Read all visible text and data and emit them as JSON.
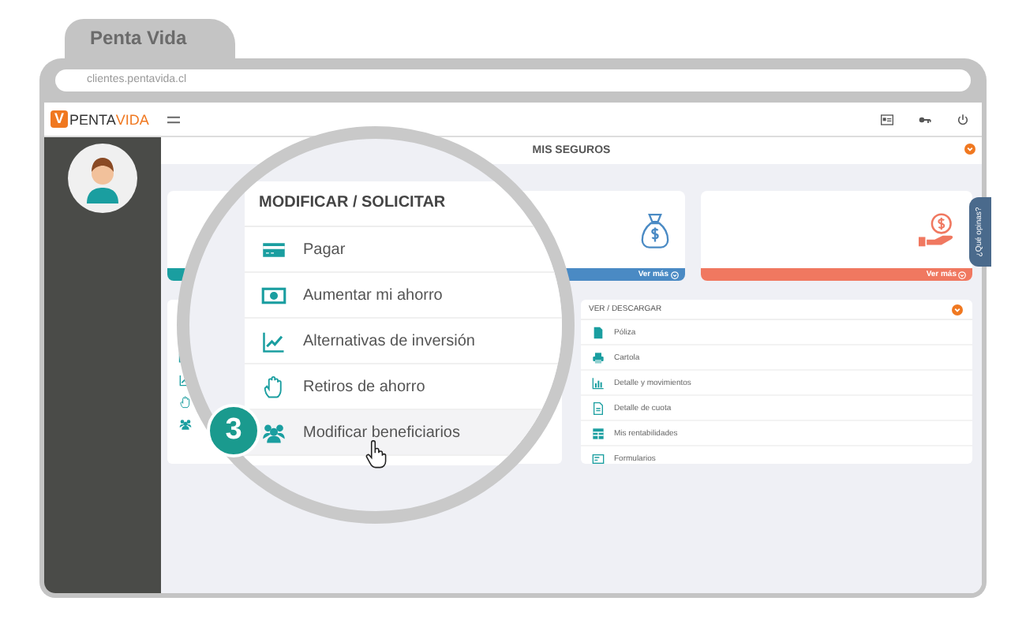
{
  "browser": {
    "tab_title": "Penta Vida",
    "url": "clientes.pentavida.cl"
  },
  "logo": {
    "mark": "V",
    "word_1": "PENTA",
    "word_2": "VIDA"
  },
  "section_title": "MIS SEGUROS",
  "cards": [
    {
      "kind": "plain",
      "color": "#1a9ea0"
    },
    {
      "kind": "money-bag",
      "color": "#4a8ac4",
      "link": "Ver más"
    },
    {
      "kind": "hand-coin",
      "color": "#f07860",
      "link": "Ver más"
    }
  ],
  "feedback_tab": "¿Qué opinas?",
  "modify_panel": {
    "items": [
      {
        "kind": "card"
      },
      {
        "kind": "cash"
      },
      {
        "kind": "chart"
      },
      {
        "kind": "hand"
      },
      {
        "kind": "people"
      }
    ]
  },
  "download_panel": {
    "title": "VER / DESCARGAR",
    "items": [
      {
        "kind": "document",
        "label": "Póliza"
      },
      {
        "kind": "printer",
        "label": "Cartola"
      },
      {
        "kind": "bar-chart",
        "label": "Detalle y movimientos"
      },
      {
        "kind": "receipt",
        "label": "Detalle de cuota"
      },
      {
        "kind": "table",
        "label": "Mis rentabilidades"
      },
      {
        "kind": "form",
        "label": "Formularios"
      }
    ]
  },
  "magnifier": {
    "title": "MODIFICAR / SOLICITAR",
    "items": [
      {
        "kind": "card",
        "label": "Pagar",
        "selected": false
      },
      {
        "kind": "cash",
        "label": "Aumentar mi ahorro",
        "selected": false
      },
      {
        "kind": "chart",
        "label": "Alternativas de inversión",
        "selected": false
      },
      {
        "kind": "hand",
        "label": "Retiros de ahorro",
        "selected": false
      },
      {
        "kind": "people",
        "label": "Modificar beneficiarios",
        "selected": true
      }
    ],
    "step": "3"
  }
}
